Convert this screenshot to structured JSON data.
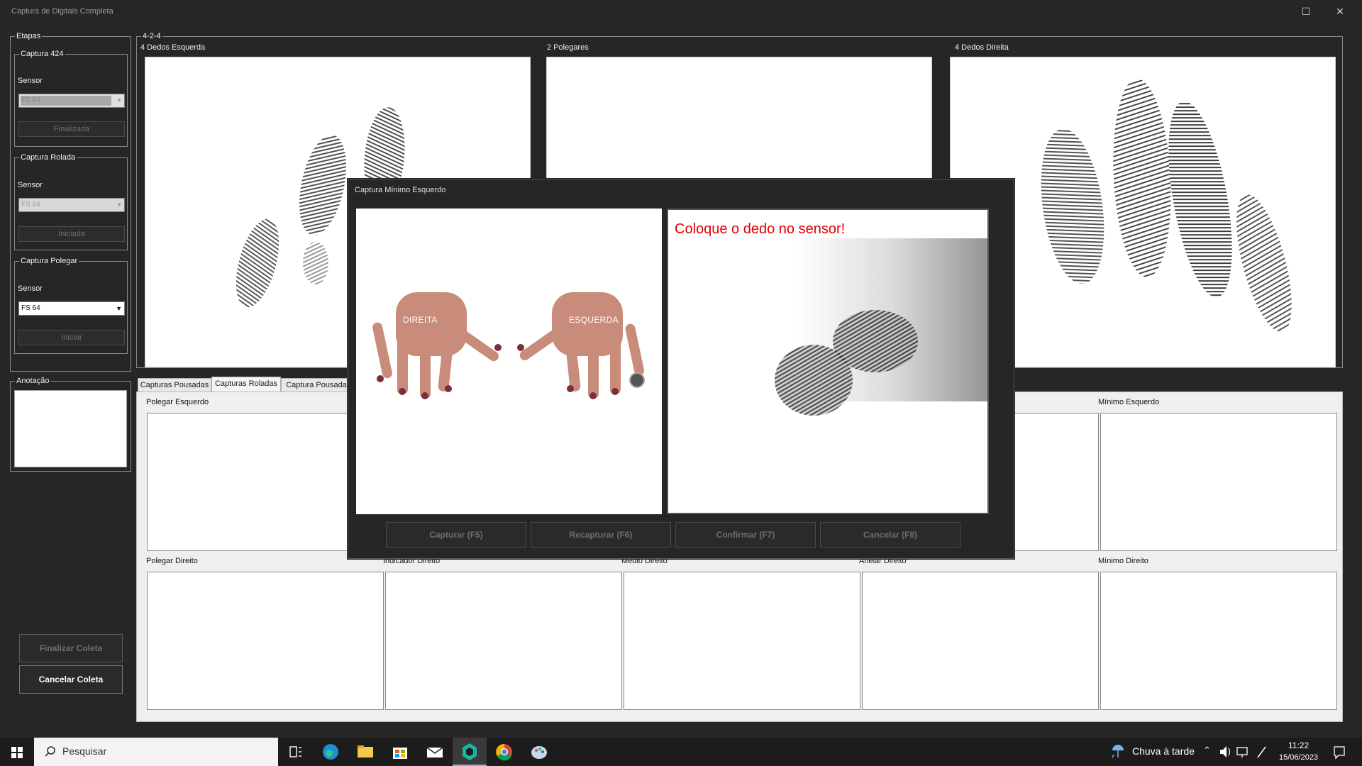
{
  "window": {
    "title": "Captura de Digitais Completa",
    "maximize_glyph": "☐",
    "close_glyph": "✕"
  },
  "left": {
    "steps_label": "Etapas",
    "groups": [
      {
        "title": "Captura 424",
        "sensor_label": "Sensor",
        "sensor_value": "FS 64",
        "button": "Finalizada"
      },
      {
        "title": "Captura Rolada",
        "sensor_label": "Sensor",
        "sensor_value": "FS 64",
        "button": "Iniciada"
      },
      {
        "title": "Captura Polegar",
        "sensor_label": "Sensor",
        "sensor_value": "FS 64",
        "button": "Iniciar"
      }
    ],
    "annotation_label": "Anotação",
    "finish_button": "Finalizar Coleta",
    "cancel_button": "Cancelar Coleta"
  },
  "main": {
    "group_label": "4-2-4",
    "top_panels": [
      "4 Dedos Esquerda",
      "2 Polegares",
      "4 Dedos Direita"
    ],
    "tabs": [
      "Capturas Pousadas",
      "Capturas Roladas",
      "Captura Pousada"
    ],
    "selected_tab": "Capturas Roladas",
    "row1": [
      "Polegar Esquerdo",
      "Mínimo Esquerdo"
    ],
    "row2": [
      "Polegar Direito",
      "Indicador Direito",
      "Médio Direito",
      "Anelar Direito",
      "Mínimo Direito"
    ]
  },
  "dialog": {
    "title": "Captura Mínimo Esquerdo",
    "hand_right": "DIREITA",
    "hand_left": "ESQUERDA",
    "message": "Coloque o dedo no sensor!",
    "buttons": [
      "Capturar (F5)",
      "Recapturar (F6)",
      "Confirmar (F7)",
      "Cancelar (F8)"
    ]
  },
  "taskbar": {
    "search_placeholder": "Pesquisar",
    "weather": "Chuva à tarde",
    "time": "11:22",
    "date": "15/06/2023"
  },
  "colors": {
    "message": "#e10000",
    "accent_app": "#1ab3a6"
  }
}
